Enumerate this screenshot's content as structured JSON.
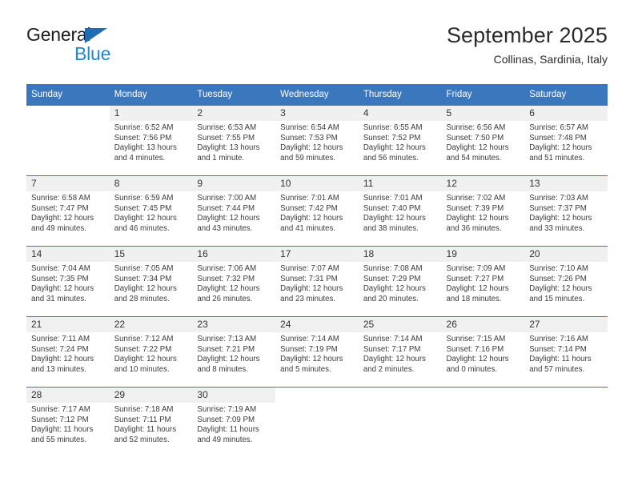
{
  "brand": {
    "name_primary": "General",
    "name_secondary": "Blue",
    "accent_color": "#1f86d8",
    "triangle_color": "#1f6cb5"
  },
  "header": {
    "title": "September 2025",
    "subtitle": "Collinas, Sardinia, Italy"
  },
  "theme": {
    "header_bar_color": "#3a77bd",
    "daynum_band_color": "#f0f0f0",
    "text_color": "#3b3b3b"
  },
  "calendar": {
    "weekday_headers": [
      "Sunday",
      "Monday",
      "Tuesday",
      "Wednesday",
      "Thursday",
      "Friday",
      "Saturday"
    ],
    "weeks": [
      [
        {
          "day": "",
          "blank": true
        },
        {
          "day": "1",
          "sunrise": "Sunrise: 6:52 AM",
          "sunset": "Sunset: 7:56 PM",
          "daylight_l1": "Daylight: 13 hours",
          "daylight_l2": "and 4 minutes."
        },
        {
          "day": "2",
          "sunrise": "Sunrise: 6:53 AM",
          "sunset": "Sunset: 7:55 PM",
          "daylight_l1": "Daylight: 13 hours",
          "daylight_l2": "and 1 minute."
        },
        {
          "day": "3",
          "sunrise": "Sunrise: 6:54 AM",
          "sunset": "Sunset: 7:53 PM",
          "daylight_l1": "Daylight: 12 hours",
          "daylight_l2": "and 59 minutes."
        },
        {
          "day": "4",
          "sunrise": "Sunrise: 6:55 AM",
          "sunset": "Sunset: 7:52 PM",
          "daylight_l1": "Daylight: 12 hours",
          "daylight_l2": "and 56 minutes."
        },
        {
          "day": "5",
          "sunrise": "Sunrise: 6:56 AM",
          "sunset": "Sunset: 7:50 PM",
          "daylight_l1": "Daylight: 12 hours",
          "daylight_l2": "and 54 minutes."
        },
        {
          "day": "6",
          "sunrise": "Sunrise: 6:57 AM",
          "sunset": "Sunset: 7:48 PM",
          "daylight_l1": "Daylight: 12 hours",
          "daylight_l2": "and 51 minutes."
        }
      ],
      [
        {
          "day": "7",
          "sunrise": "Sunrise: 6:58 AM",
          "sunset": "Sunset: 7:47 PM",
          "daylight_l1": "Daylight: 12 hours",
          "daylight_l2": "and 49 minutes."
        },
        {
          "day": "8",
          "sunrise": "Sunrise: 6:59 AM",
          "sunset": "Sunset: 7:45 PM",
          "daylight_l1": "Daylight: 12 hours",
          "daylight_l2": "and 46 minutes."
        },
        {
          "day": "9",
          "sunrise": "Sunrise: 7:00 AM",
          "sunset": "Sunset: 7:44 PM",
          "daylight_l1": "Daylight: 12 hours",
          "daylight_l2": "and 43 minutes."
        },
        {
          "day": "10",
          "sunrise": "Sunrise: 7:01 AM",
          "sunset": "Sunset: 7:42 PM",
          "daylight_l1": "Daylight: 12 hours",
          "daylight_l2": "and 41 minutes."
        },
        {
          "day": "11",
          "sunrise": "Sunrise: 7:01 AM",
          "sunset": "Sunset: 7:40 PM",
          "daylight_l1": "Daylight: 12 hours",
          "daylight_l2": "and 38 minutes."
        },
        {
          "day": "12",
          "sunrise": "Sunrise: 7:02 AM",
          "sunset": "Sunset: 7:39 PM",
          "daylight_l1": "Daylight: 12 hours",
          "daylight_l2": "and 36 minutes."
        },
        {
          "day": "13",
          "sunrise": "Sunrise: 7:03 AM",
          "sunset": "Sunset: 7:37 PM",
          "daylight_l1": "Daylight: 12 hours",
          "daylight_l2": "and 33 minutes."
        }
      ],
      [
        {
          "day": "14",
          "sunrise": "Sunrise: 7:04 AM",
          "sunset": "Sunset: 7:35 PM",
          "daylight_l1": "Daylight: 12 hours",
          "daylight_l2": "and 31 minutes."
        },
        {
          "day": "15",
          "sunrise": "Sunrise: 7:05 AM",
          "sunset": "Sunset: 7:34 PM",
          "daylight_l1": "Daylight: 12 hours",
          "daylight_l2": "and 28 minutes."
        },
        {
          "day": "16",
          "sunrise": "Sunrise: 7:06 AM",
          "sunset": "Sunset: 7:32 PM",
          "daylight_l1": "Daylight: 12 hours",
          "daylight_l2": "and 26 minutes."
        },
        {
          "day": "17",
          "sunrise": "Sunrise: 7:07 AM",
          "sunset": "Sunset: 7:31 PM",
          "daylight_l1": "Daylight: 12 hours",
          "daylight_l2": "and 23 minutes."
        },
        {
          "day": "18",
          "sunrise": "Sunrise: 7:08 AM",
          "sunset": "Sunset: 7:29 PM",
          "daylight_l1": "Daylight: 12 hours",
          "daylight_l2": "and 20 minutes."
        },
        {
          "day": "19",
          "sunrise": "Sunrise: 7:09 AM",
          "sunset": "Sunset: 7:27 PM",
          "daylight_l1": "Daylight: 12 hours",
          "daylight_l2": "and 18 minutes."
        },
        {
          "day": "20",
          "sunrise": "Sunrise: 7:10 AM",
          "sunset": "Sunset: 7:26 PM",
          "daylight_l1": "Daylight: 12 hours",
          "daylight_l2": "and 15 minutes."
        }
      ],
      [
        {
          "day": "21",
          "sunrise": "Sunrise: 7:11 AM",
          "sunset": "Sunset: 7:24 PM",
          "daylight_l1": "Daylight: 12 hours",
          "daylight_l2": "and 13 minutes."
        },
        {
          "day": "22",
          "sunrise": "Sunrise: 7:12 AM",
          "sunset": "Sunset: 7:22 PM",
          "daylight_l1": "Daylight: 12 hours",
          "daylight_l2": "and 10 minutes."
        },
        {
          "day": "23",
          "sunrise": "Sunrise: 7:13 AM",
          "sunset": "Sunset: 7:21 PM",
          "daylight_l1": "Daylight: 12 hours",
          "daylight_l2": "and 8 minutes."
        },
        {
          "day": "24",
          "sunrise": "Sunrise: 7:14 AM",
          "sunset": "Sunset: 7:19 PM",
          "daylight_l1": "Daylight: 12 hours",
          "daylight_l2": "and 5 minutes."
        },
        {
          "day": "25",
          "sunrise": "Sunrise: 7:14 AM",
          "sunset": "Sunset: 7:17 PM",
          "daylight_l1": "Daylight: 12 hours",
          "daylight_l2": "and 2 minutes."
        },
        {
          "day": "26",
          "sunrise": "Sunrise: 7:15 AM",
          "sunset": "Sunset: 7:16 PM",
          "daylight_l1": "Daylight: 12 hours",
          "daylight_l2": "and 0 minutes."
        },
        {
          "day": "27",
          "sunrise": "Sunrise: 7:16 AM",
          "sunset": "Sunset: 7:14 PM",
          "daylight_l1": "Daylight: 11 hours",
          "daylight_l2": "and 57 minutes."
        }
      ],
      [
        {
          "day": "28",
          "sunrise": "Sunrise: 7:17 AM",
          "sunset": "Sunset: 7:12 PM",
          "daylight_l1": "Daylight: 11 hours",
          "daylight_l2": "and 55 minutes."
        },
        {
          "day": "29",
          "sunrise": "Sunrise: 7:18 AM",
          "sunset": "Sunset: 7:11 PM",
          "daylight_l1": "Daylight: 11 hours",
          "daylight_l2": "and 52 minutes."
        },
        {
          "day": "30",
          "sunrise": "Sunrise: 7:19 AM",
          "sunset": "Sunset: 7:09 PM",
          "daylight_l1": "Daylight: 11 hours",
          "daylight_l2": "and 49 minutes."
        },
        {
          "day": "",
          "blank": true
        },
        {
          "day": "",
          "blank": true
        },
        {
          "day": "",
          "blank": true
        },
        {
          "day": "",
          "blank": true
        }
      ]
    ]
  }
}
